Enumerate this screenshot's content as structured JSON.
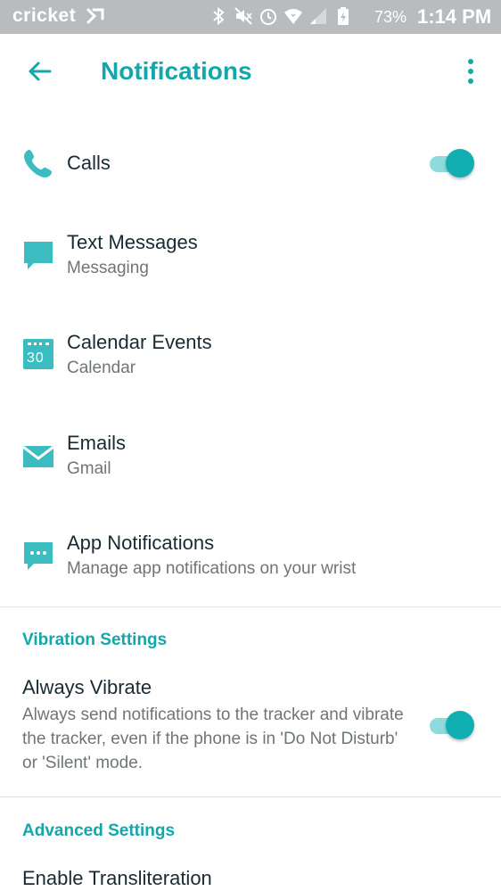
{
  "status_bar": {
    "carrier": "cricket",
    "battery": "73%",
    "time": "1:14 PM",
    "icons": [
      "bluetooth-icon",
      "mute-icon",
      "alarm-icon",
      "wifi-icon",
      "signal-icon",
      "battery-charging-icon"
    ]
  },
  "app_bar": {
    "title": "Notifications",
    "back_icon": "arrow-left-icon",
    "menu_icon": "more-vertical-icon"
  },
  "notification_items": [
    {
      "label": "Calls",
      "sublabel": "",
      "icon": "phone-icon",
      "toggle": "on"
    },
    {
      "label": "Text Messages",
      "sublabel": "Messaging",
      "icon": "message-icon"
    },
    {
      "label": "Calendar Events",
      "sublabel": "Calendar",
      "icon": "calendar-icon",
      "icon_text": "30"
    },
    {
      "label": "Emails",
      "sublabel": "Gmail",
      "icon": "mail-icon"
    },
    {
      "label": "App Notifications",
      "sublabel": "Manage app notifications on your wrist",
      "icon": "chat-dots-icon"
    }
  ],
  "vibration_section": {
    "header": "Vibration Settings",
    "title": "Always Vibrate",
    "description": "Always send notifications to the tracker and vibrate the tracker, even if the phone is in 'Do Not Disturb' or 'Silent' mode.",
    "toggle": "on"
  },
  "advanced_section": {
    "header": "Advanced Settings",
    "title": "Enable Transliteration"
  },
  "colors": {
    "accent": "#13a7ac",
    "status_bar": "#b9bcbe",
    "toggle_track": "#8fdadd",
    "toggle_knob": "#11aeb2",
    "primary_text": "#1a2a33",
    "secondary_text": "#6f7478"
  }
}
